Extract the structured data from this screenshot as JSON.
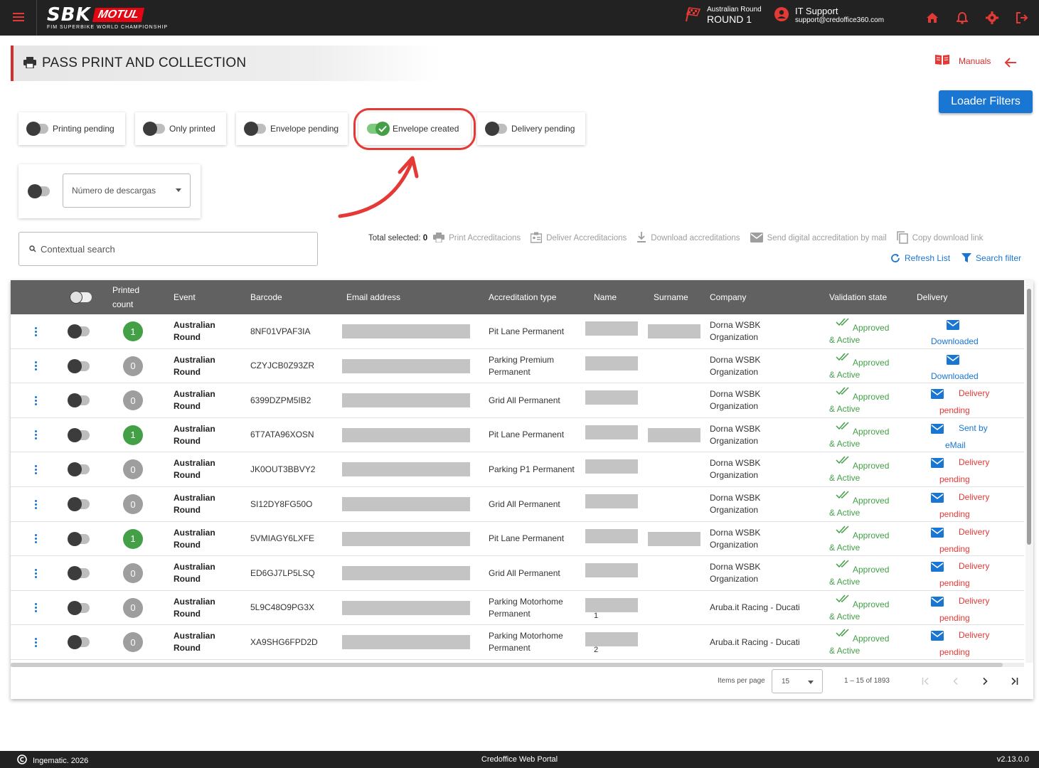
{
  "topbar": {
    "logo_main": "SBK",
    "logo_sponsor": "MOTUL",
    "logo_sub": "FIM SUPERBIKE WORLD CHAMPIONSHIP",
    "round_label": "Australian Round",
    "round_value": "ROUND 1",
    "support_title": "IT Support",
    "support_email": "support@credoffice360.com",
    "accent_color": "#e53935"
  },
  "header": {
    "title": "PASS PRINT AND COLLECTION",
    "manuals_label": "Manuals",
    "loader_filters_label": "Loader Filters"
  },
  "filters": [
    {
      "label": "Printing pending",
      "on": false
    },
    {
      "label": "Only printed",
      "on": false
    },
    {
      "label": "Envelope pending",
      "on": false
    },
    {
      "label": "Envelope created",
      "on": true
    },
    {
      "label": "Delivery pending",
      "on": false
    }
  ],
  "downloads_select": {
    "placeholder": "Número de descargas"
  },
  "search": {
    "placeholder": "Contextual search"
  },
  "actions": {
    "total_label": "Total selected:",
    "total_value": "0",
    "print": "Print Accreditacions",
    "deliver": "Deliver Accreditacions",
    "download": "Download accreditations",
    "send_mail": "Send digital accreditation by mail",
    "copy_link": "Copy download link",
    "refresh": "Refresh List",
    "search_filter": "Search filter"
  },
  "table": {
    "columns": {
      "printed_count_1": "Printed",
      "printed_count_2": "count",
      "event": "Event",
      "barcode": "Barcode",
      "email": "Email address",
      "accreditation_type": "Accreditation type",
      "name": "Name",
      "surname": "Surname",
      "company": "Company",
      "validation": "Validation state",
      "delivery": "Delivery"
    },
    "rows": [
      {
        "count": "1",
        "event1": "Australian",
        "event2": "Round",
        "barcode": "8NF01VPAF3IA",
        "type1": "Pit Lane Permanent",
        "type2": "",
        "name_extra": "",
        "surname_redacted": true,
        "company1": "Dorna WSBK",
        "company2": "Organization",
        "val1": "Approved",
        "val2": "& Active",
        "del1": "",
        "del2": "Downloaded",
        "del_color": "blue"
      },
      {
        "count": "0",
        "event1": "Australian",
        "event2": "Round",
        "barcode": "CZYJCB0Z93ZR",
        "type1": "Parking Premium",
        "type2": "Permanent",
        "name_extra": "",
        "surname_redacted": false,
        "company1": "Dorna WSBK",
        "company2": "Organization",
        "val1": "Approved",
        "val2": "& Active",
        "del1": "",
        "del2": "Downloaded",
        "del_color": "blue"
      },
      {
        "count": "0",
        "event1": "Australian",
        "event2": "Round",
        "barcode": "6399DZPM5IB2",
        "type1": "Grid All Permanent",
        "type2": "",
        "name_extra": "",
        "surname_redacted": false,
        "company1": "Dorna WSBK",
        "company2": "Organization",
        "val1": "Approved",
        "val2": "& Active",
        "del1": "Delivery",
        "del2": "pending",
        "del_color": "red"
      },
      {
        "count": "1",
        "event1": "Australian",
        "event2": "Round",
        "barcode": "6T7ATA96XOSN",
        "type1": "Pit Lane Permanent",
        "type2": "",
        "name_extra": "",
        "surname_redacted": true,
        "company1": "Dorna WSBK",
        "company2": "Organization",
        "val1": "Approved",
        "val2": "& Active",
        "del1": "Sent by",
        "del2": "eMail",
        "del_color": "blue"
      },
      {
        "count": "0",
        "event1": "Australian",
        "event2": "Round",
        "barcode": "JK0OUT3BBVY2",
        "type1": "Parking P1 Permanent",
        "type2": "",
        "name_extra": "",
        "surname_redacted": false,
        "company1": "Dorna WSBK",
        "company2": "Organization",
        "val1": "Approved",
        "val2": "& Active",
        "del1": "Delivery",
        "del2": "pending",
        "del_color": "red"
      },
      {
        "count": "0",
        "event1": "Australian",
        "event2": "Round",
        "barcode": "SI12DY8FG50O",
        "type1": "Grid All Permanent",
        "type2": "",
        "name_extra": "",
        "surname_redacted": false,
        "company1": "Dorna WSBK",
        "company2": "Organization",
        "val1": "Approved",
        "val2": "& Active",
        "del1": "Delivery",
        "del2": "pending",
        "del_color": "red"
      },
      {
        "count": "1",
        "event1": "Australian",
        "event2": "Round",
        "barcode": "5VMIAGY6LXFE",
        "type1": "Pit Lane Permanent",
        "type2": "",
        "name_extra": "",
        "surname_redacted": true,
        "company1": "Dorna WSBK",
        "company2": "Organization",
        "val1": "Approved",
        "val2": "& Active",
        "del1": "Delivery",
        "del2": "pending",
        "del_color": "red"
      },
      {
        "count": "0",
        "event1": "Australian",
        "event2": "Round",
        "barcode": "ED6GJ7LP5LSQ",
        "type1": "Grid All Permanent",
        "type2": "",
        "name_extra": "",
        "surname_redacted": false,
        "company1": "Dorna WSBK",
        "company2": "Organization",
        "val1": "Approved",
        "val2": "& Active",
        "del1": "Delivery",
        "del2": "pending",
        "del_color": "red"
      },
      {
        "count": "0",
        "event1": "Australian",
        "event2": "Round",
        "barcode": "5L9C48O9PG3X",
        "type1": "Parking Motorhome",
        "type2": "Permanent",
        "name_extra": "1",
        "surname_redacted": false,
        "company1": "Aruba.it Racing - Ducati",
        "company2": "",
        "val1": "Approved",
        "val2": "& Active",
        "del1": "Delivery",
        "del2": "pending",
        "del_color": "red"
      },
      {
        "count": "0",
        "event1": "Australian",
        "event2": "Round",
        "barcode": "XA9SHG6FPD2D",
        "type1": "Parking Motorhome",
        "type2": "Permanent",
        "name_extra": "2",
        "surname_redacted": false,
        "company1": "Aruba.it Racing - Ducati",
        "company2": "",
        "val1": "Approved",
        "val2": "& Active",
        "del1": "Delivery",
        "del2": "pending",
        "del_color": "red"
      }
    ]
  },
  "paginator": {
    "items_per_page_label": "Items per page",
    "items_per_page": "15",
    "range": "1 – 15 of 1893"
  },
  "footer": {
    "left": "Ingematic. 2026",
    "center": "Credoffice Web Portal",
    "version": "v2.13.0.0"
  }
}
